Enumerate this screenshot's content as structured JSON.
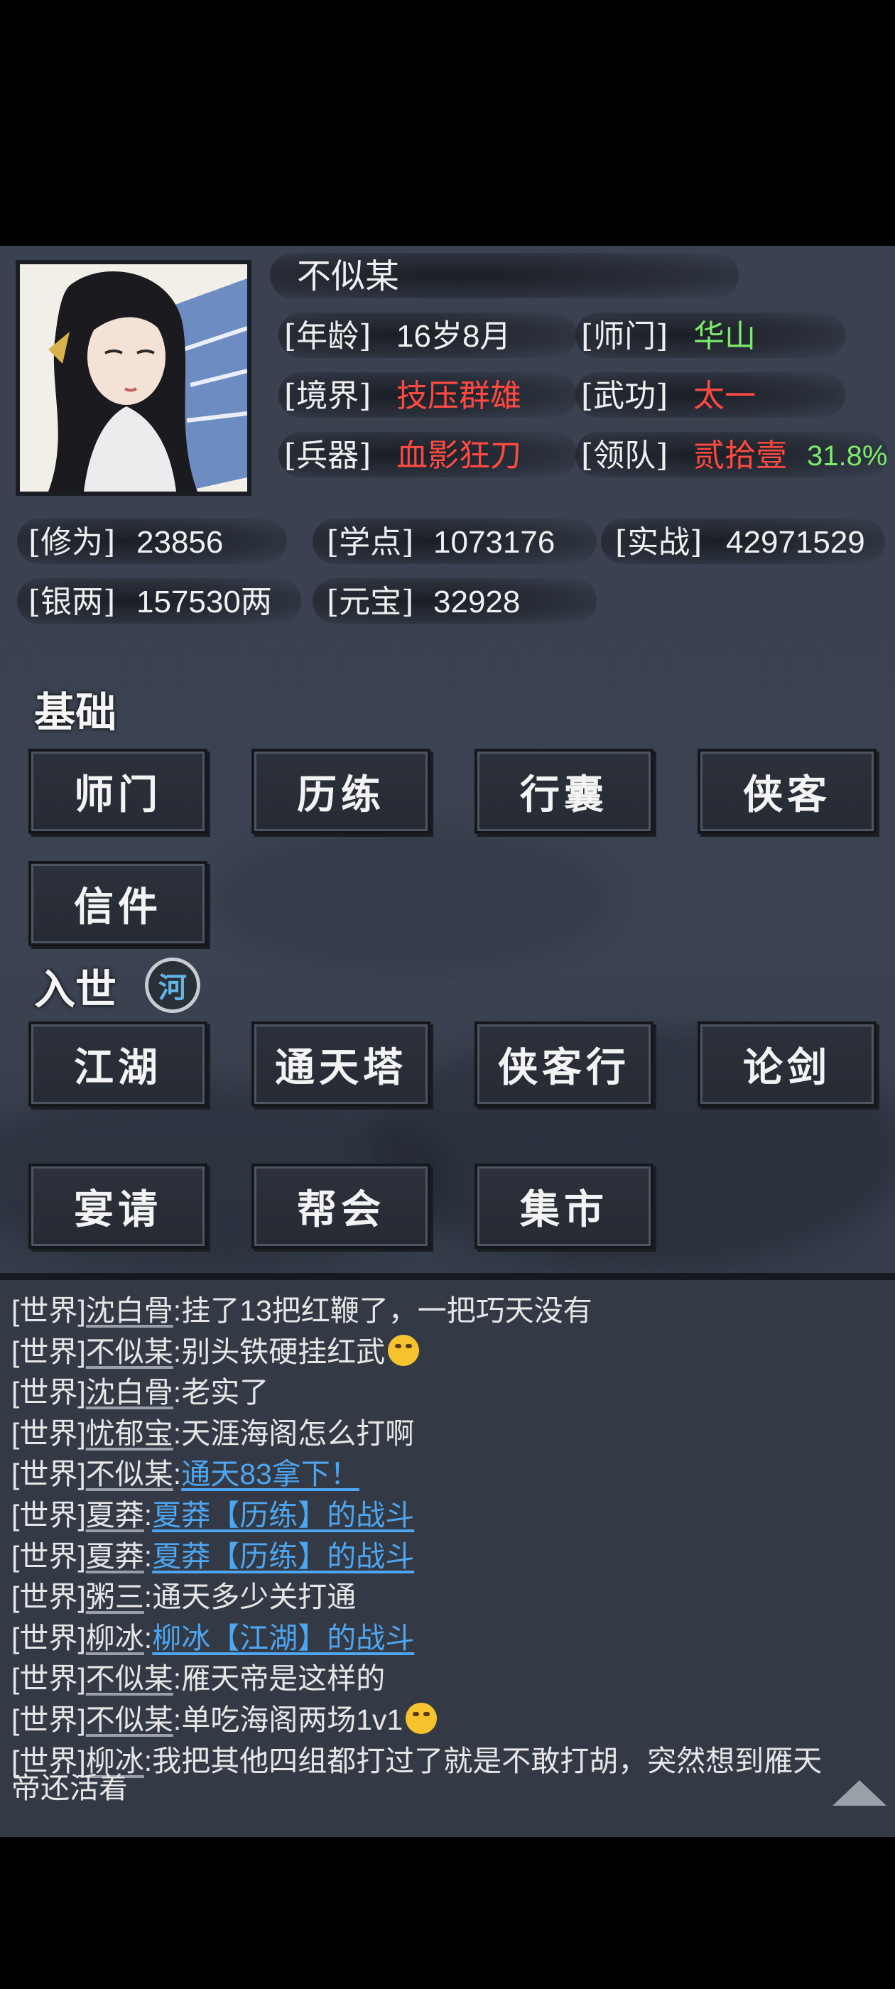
{
  "profile": {
    "name": "不似某",
    "age_label": "[年龄]",
    "age": "16岁8月",
    "sect_label": "[师门]",
    "sect": "华山",
    "realm_label": "[境界]",
    "realm": "技压群雄",
    "martial_label": "[武功]",
    "martial": "太一",
    "weapon_label": "[兵器]",
    "weapon": "血影狂刀",
    "team_label": "[领队]",
    "team": "贰拾壹",
    "team_pct": "31.8%"
  },
  "stats": {
    "cultivation_label": "[修为]",
    "cultivation": "23856",
    "study_label": "[学点]",
    "study": "1073176",
    "combat_label": "[实战]",
    "combat": "42971529",
    "silver_label": "[银两]",
    "silver": "157530两",
    "ingot_label": "[元宝]",
    "ingot": "32928"
  },
  "basic": {
    "title": "基础",
    "buttons": [
      "师门",
      "历练",
      "行囊",
      "侠客",
      "信件"
    ]
  },
  "world": {
    "title": "入世",
    "badge": "河",
    "buttons": [
      "江湖",
      "通天塔",
      "侠客行",
      "论剑",
      "宴请",
      "帮会",
      "集市"
    ]
  },
  "chat": [
    {
      "channel": "[世界]",
      "name": "沈白骨",
      "sep": ":",
      "msg": "挂了13把红鞭了，一把巧天没有",
      "link": "",
      "emoji": ""
    },
    {
      "channel": "[世界]",
      "name": "不似某",
      "sep": ":",
      "msg": "别头铁硬挂红武",
      "link": "",
      "emoji": "laughing-tears"
    },
    {
      "channel": "[世界]",
      "name": "沈白骨",
      "sep": ":",
      "msg": "老实了",
      "link": "",
      "emoji": ""
    },
    {
      "channel": "[世界]",
      "name": "忧郁宝",
      "sep": ":",
      "msg": "天涯海阁怎么打啊",
      "link": "",
      "emoji": ""
    },
    {
      "channel": "[世界]",
      "name": "不似某",
      "sep": ":",
      "msg": "",
      "link": "通天83拿下！",
      "emoji": ""
    },
    {
      "channel": "[世界]",
      "name": "夏莽",
      "sep": ":",
      "msg": "",
      "link": "夏莽【历练】的战斗",
      "emoji": ""
    },
    {
      "channel": "[世界]",
      "name": "夏莽",
      "sep": ":",
      "msg": "",
      "link": "夏莽【历练】的战斗",
      "emoji": ""
    },
    {
      "channel": "[世界]",
      "name": "粥三",
      "sep": ":",
      "msg": "通天多少关打通",
      "link": "",
      "emoji": ""
    },
    {
      "channel": "[世界]",
      "name": "柳冰",
      "sep": ":",
      "msg": "",
      "link": "柳冰【江湖】的战斗",
      "emoji": ""
    },
    {
      "channel": "[世界]",
      "name": "不似某",
      "sep": ":",
      "msg": "雁天帝是这样的",
      "link": "",
      "emoji": ""
    },
    {
      "channel": "[世界]",
      "name": "不似某",
      "sep": ":",
      "msg": "单吃海阁两场1v1",
      "link": "",
      "emoji": "smirk"
    },
    {
      "channel": "[世界]",
      "name": "柳冰",
      "sep": ":",
      "msg": "我把其他四组都打过了就是不敢打胡，突然想到雁天",
      "link": "",
      "emoji": ""
    }
  ],
  "chat_wrap": "帝还活着"
}
